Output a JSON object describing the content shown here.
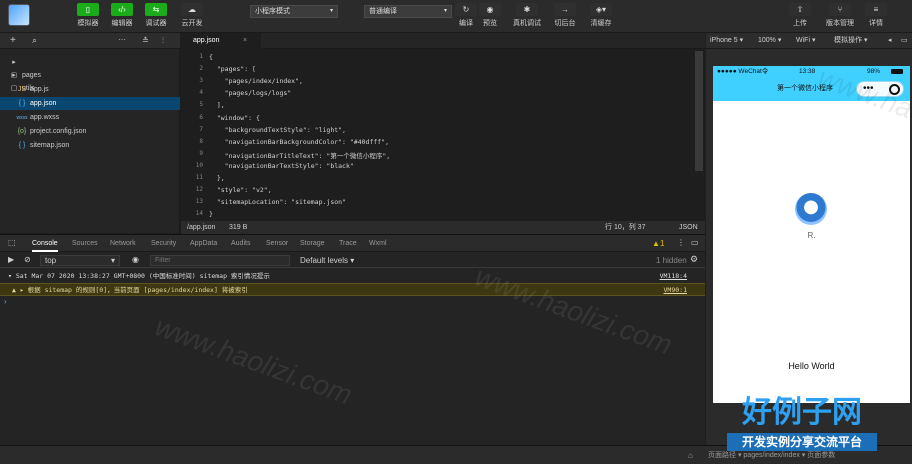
{
  "toolbar": {
    "buttons": [
      "模拟器",
      "编辑器",
      "调试器",
      "云开发"
    ],
    "mode_select": "小程序模式",
    "compile_select": "普通编译",
    "actions": [
      "编译",
      "预览",
      "真机调试",
      "切后台",
      "清缓存"
    ],
    "right_actions": [
      "上传",
      "版本管理",
      "详情"
    ]
  },
  "explorer": {
    "files": [
      {
        "icon": "▸ ▢",
        "name": "pages"
      },
      {
        "icon": "▸ ▢",
        "name": "utils"
      },
      {
        "icon": "JS",
        "name": "app.js"
      },
      {
        "icon": "{ }",
        "name": "app.json"
      },
      {
        "icon": "wxss",
        "name": "app.wxss"
      },
      {
        "icon": "{o}",
        "name": "project.config.json"
      },
      {
        "icon": "{ }",
        "name": "sitemap.json"
      }
    ]
  },
  "editor": {
    "tab": "app.json",
    "lines": [
      "{",
      "  \"pages\": [",
      "    \"pages/index/index\",",
      "    \"pages/logs/logs\"",
      "  ],",
      "  \"window\": {",
      "    \"backgroundTextStyle\": \"light\",",
      "    \"navigationBarBackgroundColor\": \"#40dfff\",",
      "    \"navigationBarTitleText\": \"第一个微信小程序\",",
      "    \"navigationBarTextStyle\": \"black\"",
      "  },",
      "  \"style\": \"v2\",",
      "  \"sitemapLocation\": \"sitemap.json\"",
      "}"
    ],
    "line_numbers": [
      "1",
      "2",
      "3",
      "4",
      "5",
      "6",
      "7",
      "8",
      "9",
      "10",
      "11",
      "12",
      "13",
      "14"
    ]
  },
  "statusbar": {
    "path": "/app.json",
    "size": "319 B",
    "position": "行 10，列 37",
    "lang": "JSON"
  },
  "devtools": {
    "tabs": [
      "Console",
      "Sources",
      "Network",
      "Security",
      "AppData",
      "Audits",
      "Sensor",
      "Storage",
      "Trace",
      "Wxml"
    ],
    "warn_count": "1",
    "context": "top",
    "filter_placeholder": "Filter",
    "levels": "Default levels ▾",
    "hidden": "1 hidden",
    "logs": [
      {
        "text": "▾ Sat Mar 07 2020 13:38:27 GMT+0800 (中国标准时间) sitemap 索引情况提示",
        "src": "VM118:4",
        "warn": false
      },
      {
        "text": "▲ ▸ 根据 sitemap 的规则[0]，当前页面 [pages/index/index] 将被索引",
        "src": "VM90:1",
        "warn": true
      }
    ]
  },
  "simulator": {
    "device": "iPhone 5 ▾",
    "zoom": "100% ▾",
    "network": "WiFi ▾",
    "ops": "模拟操作 ▾",
    "status_left": "●●●●● WeChat令",
    "status_time": "13:38",
    "status_right": "98%",
    "nav_title": "第一个微信小程序",
    "user_name": "R.",
    "hello": "Hello World"
  },
  "watermark": "www.haolizi.com",
  "logo": {
    "main": "好例子网",
    "sub": "开发实例分享交流平台"
  },
  "bottom": {
    "left": "",
    "right": "页面路径 ▾   pages/index/index ▾   页面参数"
  },
  "colors": {
    "accent": "#1aad19",
    "nav": "#40d0ff",
    "selection": "#094771",
    "warn_bg": "#3d3811"
  }
}
